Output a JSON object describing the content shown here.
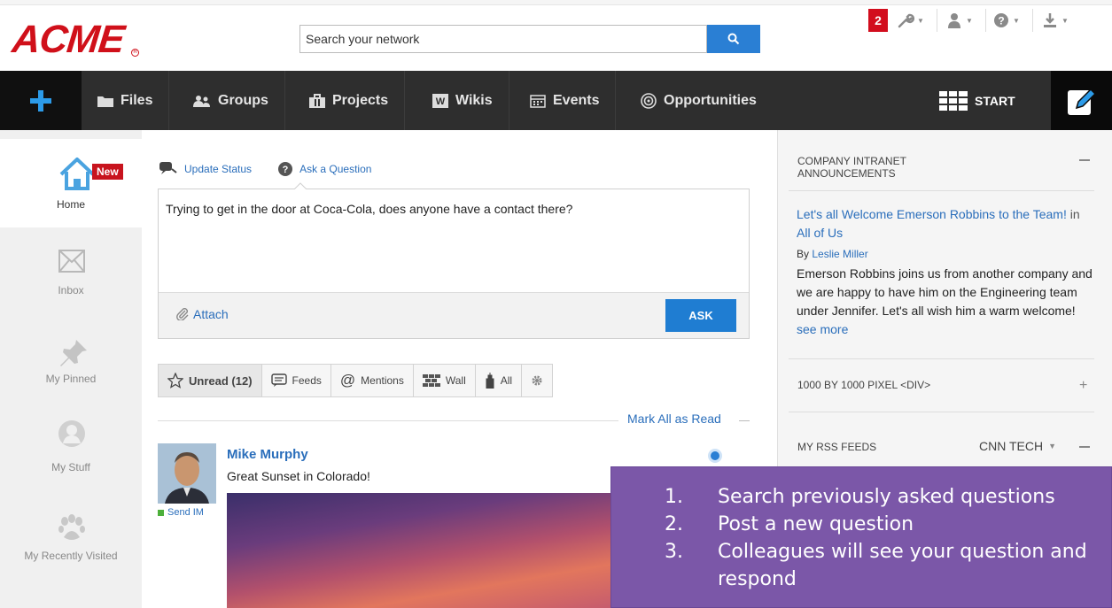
{
  "header": {
    "logo": "ACME",
    "search_placeholder": "Search your network",
    "notification_count": "2"
  },
  "nav": {
    "items": [
      {
        "label": "Files",
        "icon": "folder-icon"
      },
      {
        "label": "Groups",
        "icon": "groups-icon"
      },
      {
        "label": "Projects",
        "icon": "briefcase-icon"
      },
      {
        "label": "Wikis",
        "icon": "wiki-icon"
      },
      {
        "label": "Events",
        "icon": "calendar-icon"
      },
      {
        "label": "Opportunities",
        "icon": "target-icon"
      }
    ],
    "start_label": "START"
  },
  "sidebar": {
    "new_badge": "New",
    "items": [
      {
        "label": "Home",
        "icon": "home-icon"
      },
      {
        "label": "Inbox",
        "icon": "mail-icon"
      },
      {
        "label": "My Pinned",
        "icon": "pin-icon"
      },
      {
        "label": "My Stuff",
        "icon": "user-circle-icon"
      },
      {
        "label": "My Recently Visited",
        "icon": "paw-icon"
      }
    ]
  },
  "composer": {
    "update_status": "Update Status",
    "ask_question": "Ask a Question",
    "text": "Trying to get in the door at Coca-Cola, does anyone have a contact there?",
    "attach": "Attach",
    "ask_button": "ASK"
  },
  "filters": [
    {
      "label": "Unread (12)",
      "icon": "star-icon"
    },
    {
      "label": "Feeds",
      "icon": "feed-icon"
    },
    {
      "label": "Mentions",
      "icon": "at-icon"
    },
    {
      "label": "Wall",
      "icon": "wall-icon"
    },
    {
      "label": "All",
      "icon": "building-icon"
    },
    {
      "label": "",
      "icon": "gear-icon"
    }
  ],
  "feed": {
    "mark_all": "Mark All as Read",
    "post": {
      "author": "Mike Murphy",
      "text": "Great Sunset in Colorado!",
      "send_im": "Send IM"
    }
  },
  "right": {
    "announcements_title": "COMPANY INTRANET ANNOUNCEMENTS",
    "ann_link": "Let's all Welcome Emerson Robbins to the Team!",
    "ann_in": "in",
    "ann_group": "All of Us",
    "ann_by": "By",
    "ann_author": "Leslie Miller",
    "ann_body": "Emerson Robbins joins us from another company and we are happy to have him on the Engineering team under Jennifer. Let's all wish him a warm welcome!",
    "ann_more": "see more",
    "div_widget": "1000 BY 1000 PIXEL <DIV>",
    "rss_title": "MY RSS FEEDS",
    "rss_select": "CNN TECH"
  },
  "overlay": {
    "steps": [
      {
        "n": "1.",
        "text": "Search previously asked questions"
      },
      {
        "n": "2.",
        "text": "Post a new question"
      },
      {
        "n": "3.",
        "text": "Colleagues will see your question and respond"
      }
    ]
  },
  "colors": {
    "brand_red": "#d0101a",
    "accent_blue": "#1f7dd2",
    "nav_dark": "#2e2e2e",
    "overlay_purple": "#7b57a8"
  }
}
